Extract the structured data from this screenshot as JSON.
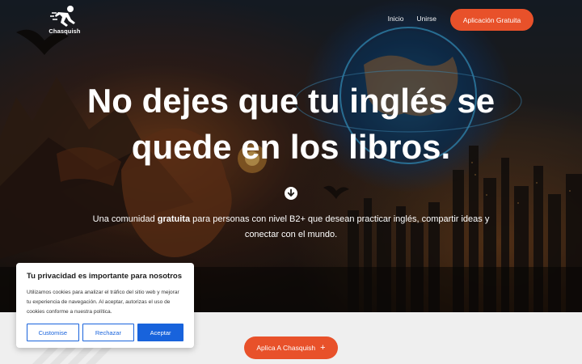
{
  "header": {
    "logo_text": "Chasquish",
    "nav": [
      "Inicio",
      "Unirse"
    ],
    "cta_label": "Aplicación Gratuita"
  },
  "hero": {
    "headline_bold": "No dejes que tu inglés",
    "headline_regular_1": " se",
    "headline_line2": "quede en los libros.",
    "subtitle_pre": "Una comunidad ",
    "subtitle_bold": "gratuita",
    "subtitle_post": " para personas con nivel B2+ que desean practicar inglés, compartir ideas y conectar con el mundo."
  },
  "cta_bottom": {
    "label": "Aplica A Chasquish",
    "icon": "plus-icon"
  },
  "cookie_banner": {
    "title": "Tu privacidad es importante para nosotros",
    "body": "Utilizamos cookies para analizar el tráfico del sitio web y mejorar tu experiencia de navegación. Al aceptar, autorizas el uso de cookies conforme a nuestra política.",
    "customize_label": "Customise",
    "reject_label": "Rechazar",
    "accept_label": "Aceptar"
  },
  "colors": {
    "accent_orange": "#e8512a",
    "cookie_blue": "#1863dc"
  },
  "icons": [
    "runner-logo-icon",
    "arrow-down-circle-icon",
    "plus-icon"
  ]
}
